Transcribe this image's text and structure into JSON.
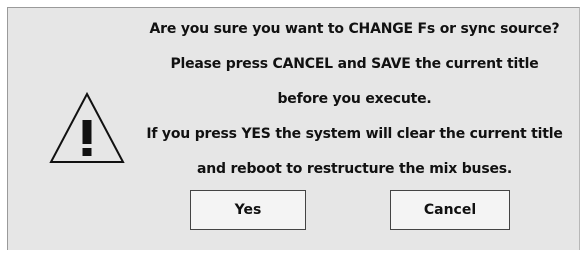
{
  "dialog": {
    "icon": "warning-triangle-icon",
    "message_lines": [
      "Are you sure you want to CHANGE Fs or sync source?",
      "Please press CANCEL and SAVE the current title",
      "before you execute.",
      "If you press YES the system will clear the current title",
      "and reboot to restructure the mix buses."
    ],
    "buttons": {
      "yes_label": "Yes",
      "cancel_label": "Cancel"
    }
  }
}
